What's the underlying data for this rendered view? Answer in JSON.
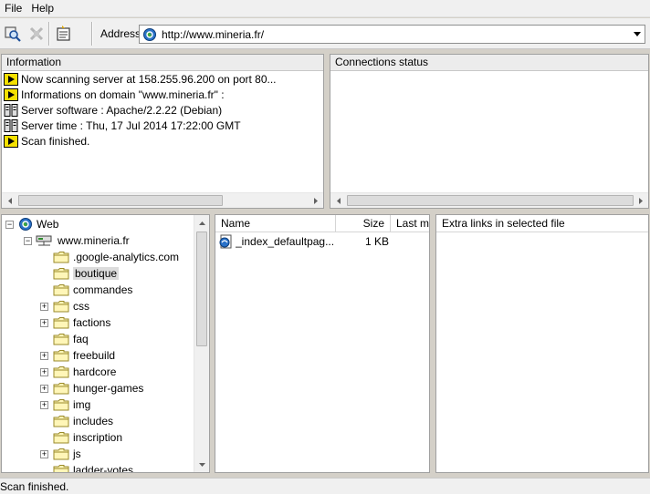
{
  "menu": {
    "file": "File",
    "help": "Help"
  },
  "toolbar": {
    "address_label": "Address",
    "address_value": "http://www.mineria.fr/"
  },
  "information": {
    "title": "Information",
    "lines": [
      {
        "icon": "arrow-icon",
        "text": "Now scanning server at 158.255.96.200 on port 80..."
      },
      {
        "icon": "arrow-icon",
        "text": "Informations on domain \"www.mineria.fr\" :"
      },
      {
        "icon": "server-icon",
        "text": "Server software : Apache/2.2.22 (Debian)"
      },
      {
        "icon": "server-icon",
        "text": "Server time : Thu, 17 Jul 2014 17:22:00 GMT"
      },
      {
        "icon": "arrow-icon",
        "text": "Scan finished."
      }
    ]
  },
  "connections": {
    "title": "Connections status"
  },
  "tree": {
    "root": "Web",
    "host": "www.mineria.fr",
    "folders": [
      {
        "name": ".google-analytics.com",
        "expandable": false
      },
      {
        "name": "boutique",
        "expandable": false,
        "selected": true
      },
      {
        "name": "commandes",
        "expandable": false
      },
      {
        "name": "css",
        "expandable": true
      },
      {
        "name": "factions",
        "expandable": true
      },
      {
        "name": "faq",
        "expandable": false
      },
      {
        "name": "freebuild",
        "expandable": true
      },
      {
        "name": "hardcore",
        "expandable": true
      },
      {
        "name": "hunger-games",
        "expandable": true
      },
      {
        "name": "img",
        "expandable": true
      },
      {
        "name": "includes",
        "expandable": false
      },
      {
        "name": "inscription",
        "expandable": false
      },
      {
        "name": "js",
        "expandable": true
      },
      {
        "name": "ladder-votes",
        "expandable": false
      }
    ]
  },
  "files": {
    "columns": {
      "name": "Name",
      "size": "Size",
      "last": "Last m"
    },
    "rows": [
      {
        "name": "_index_defaultpag...",
        "size": "1 KB"
      }
    ]
  },
  "extra_links": {
    "title": "Extra links in selected file"
  },
  "status": {
    "text": "Scan finished."
  }
}
